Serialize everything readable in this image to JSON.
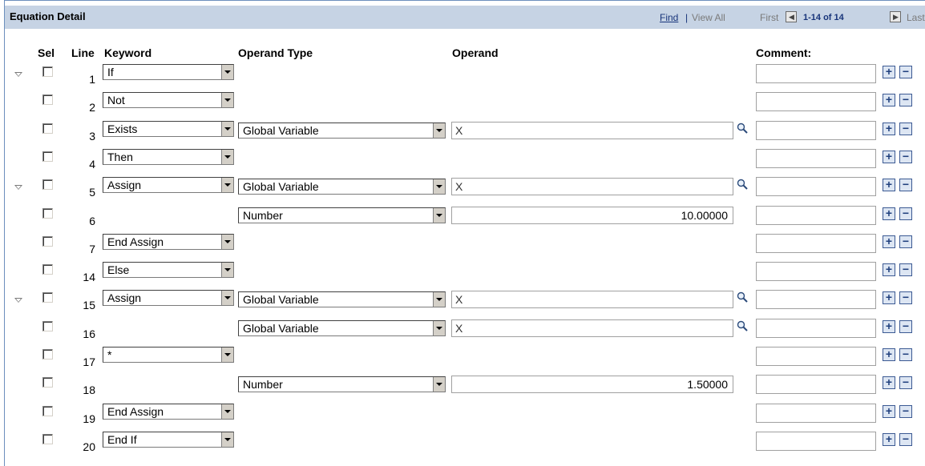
{
  "header": {
    "title": "Equation Detail",
    "find": "Find",
    "separator": "|",
    "view_all": "View All",
    "first": "First",
    "range": "1-14 of 14",
    "last": "Last"
  },
  "columns": {
    "sel": "Sel",
    "line": "Line",
    "keyword": "Keyword",
    "operand_type": "Operand Type",
    "operand": "Operand",
    "comment": "Comment:"
  },
  "rows": [
    {
      "line": "1",
      "keyword": "If",
      "operand_type": "",
      "operand": "",
      "collapsible": true
    },
    {
      "line": "2",
      "keyword": "Not",
      "operand_type": "",
      "operand": "",
      "collapsible": false
    },
    {
      "line": "3",
      "keyword": "Exists",
      "operand_type": "Global Variable",
      "operand": "X",
      "collapsible": false
    },
    {
      "line": "4",
      "keyword": "Then",
      "operand_type": "",
      "operand": "",
      "collapsible": false
    },
    {
      "line": "5",
      "keyword": "Assign",
      "operand_type": "Global Variable",
      "operand": "X",
      "collapsible": true
    },
    {
      "line": "6",
      "keyword": "",
      "operand_type": "Number",
      "operand": "10.00000",
      "collapsible": false
    },
    {
      "line": "7",
      "keyword": "End Assign",
      "operand_type": "",
      "operand": "",
      "collapsible": false
    },
    {
      "line": "14",
      "keyword": "Else",
      "operand_type": "",
      "operand": "",
      "collapsible": false
    },
    {
      "line": "15",
      "keyword": "Assign",
      "operand_type": "Global Variable",
      "operand": "X",
      "collapsible": true
    },
    {
      "line": "16",
      "keyword": "",
      "operand_type": "Global Variable",
      "operand": "X",
      "collapsible": false
    },
    {
      "line": "17",
      "keyword": "*",
      "operand_type": "",
      "operand": "",
      "collapsible": false
    },
    {
      "line": "18",
      "keyword": "",
      "operand_type": "Number",
      "operand": "1.50000",
      "collapsible": false
    },
    {
      "line": "19",
      "keyword": "End Assign",
      "operand_type": "",
      "operand": "",
      "collapsible": false
    },
    {
      "line": "20",
      "keyword": "End If",
      "operand_type": "",
      "operand": "",
      "collapsible": false
    }
  ],
  "buttons": {
    "add": "+",
    "delete": "−"
  },
  "icons": {
    "collapse": "collapse-triangle-icon",
    "lookup": "magnifier-icon"
  },
  "colors": {
    "header_bg": "#c6d3e4",
    "link": "#17347a",
    "border": "#6c8fbd"
  }
}
